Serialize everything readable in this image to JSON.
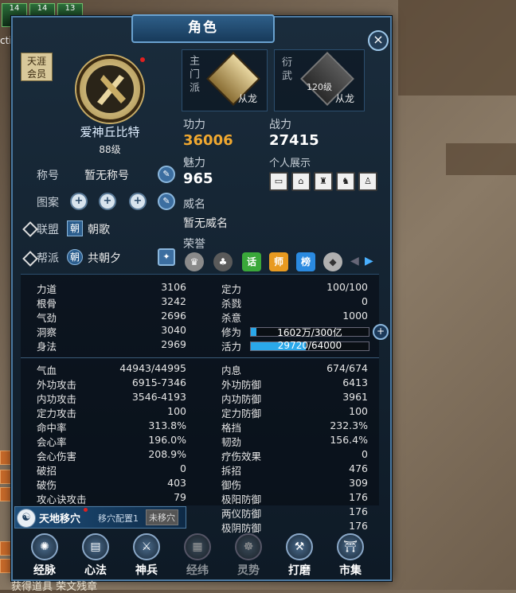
{
  "skill_bar": {
    "counts": [
      "14",
      "14",
      "13"
    ],
    "side_text": "cti"
  },
  "window": {
    "title": "角色",
    "close_symbol": "×"
  },
  "profile": {
    "badge": "天涯\n会员",
    "name": "爱神丘比特",
    "level": "88级",
    "title_label": "称号",
    "title_value": "暂无称号",
    "pattern_label": "图案",
    "alliance_label": "联盟",
    "alliance_tag": "朝",
    "alliance_name": "朝歌",
    "guild_label": "帮派",
    "guild_tag": "朝",
    "guild_name": "共朝夕"
  },
  "sects": {
    "main_label": "主门派",
    "main_name": "从龙",
    "practice_label": "衍武",
    "practice_level": "120级",
    "practice_name": "从龙"
  },
  "power": {
    "gongli_label": "功力",
    "gongli_value": "36006",
    "zhanli_label": "战力",
    "zhanli_value": "27415",
    "meili_label": "魅力",
    "meili_value": "965",
    "personal_show_label": "个人展示",
    "weiming_label": "威名",
    "weiming_value": "暂无威名",
    "honor_label": "荣誉"
  },
  "honor_icons": [
    "话",
    "师",
    "榜"
  ],
  "honor_badge_nums": [
    "1",
    "1",
    "1"
  ],
  "basic_stats_left": [
    {
      "k": "力道",
      "v": "3106"
    },
    {
      "k": "根骨",
      "v": "3242"
    },
    {
      "k": "气劲",
      "v": "2696"
    },
    {
      "k": "洞察",
      "v": "3040"
    },
    {
      "k": "身法",
      "v": "2969"
    }
  ],
  "basic_stats_right": [
    {
      "k": "定力",
      "v": "100/100"
    },
    {
      "k": "杀戮",
      "v": "0"
    },
    {
      "k": "杀意",
      "v": "1000"
    }
  ],
  "xiuwei": {
    "label": "修为",
    "text": "1602万/300亿",
    "fraction": 0.05
  },
  "huoli": {
    "label": "活力",
    "text": "29720/64000",
    "fraction": 0.464
  },
  "combat_left": [
    {
      "k": "气血",
      "v": "44943/44995"
    },
    {
      "k": "外功攻击",
      "v": "6915-7346"
    },
    {
      "k": "内功攻击",
      "v": "3546-4193"
    },
    {
      "k": "定力攻击",
      "v": "100"
    },
    {
      "k": "命中率",
      "v": "313.8%"
    },
    {
      "k": "会心率",
      "v": "196.0%"
    },
    {
      "k": "会心伤害",
      "v": "208.9%"
    },
    {
      "k": "破招",
      "v": "0"
    },
    {
      "k": "破伤",
      "v": "403"
    },
    {
      "k": "攻心诀攻击",
      "v": "79"
    }
  ],
  "combat_right": [
    {
      "k": "内息",
      "v": "674/674"
    },
    {
      "k": "外功防御",
      "v": "6413"
    },
    {
      "k": "内功防御",
      "v": "3961"
    },
    {
      "k": "定力防御",
      "v": "100"
    },
    {
      "k": "格挡",
      "v": "232.3%"
    },
    {
      "k": "韧劲",
      "v": "156.4%"
    },
    {
      "k": "疗伤效果",
      "v": "0"
    },
    {
      "k": "拆招",
      "v": "476"
    },
    {
      "k": "御伤",
      "v": "309"
    },
    {
      "k": "极阳防御",
      "v": "176"
    },
    {
      "k": "两仪防御",
      "v": "176"
    },
    {
      "k": "极阴防御",
      "v": "176"
    }
  ],
  "tiandi": {
    "label": "天地移穴",
    "config": "移穴配置1",
    "status": "未移穴"
  },
  "nav": [
    {
      "label": "经脉",
      "icon": "meridian-icon",
      "dim": false
    },
    {
      "label": "心法",
      "icon": "book-icon",
      "dim": false
    },
    {
      "label": "神兵",
      "icon": "sword-icon",
      "dim": false
    },
    {
      "label": "经纬",
      "icon": "grid-icon",
      "dim": true
    },
    {
      "label": "灵势",
      "icon": "spirit-icon",
      "dim": true
    },
    {
      "label": "打磨",
      "icon": "hammer-icon",
      "dim": false
    },
    {
      "label": "市集",
      "icon": "market-icon",
      "dim": false
    }
  ],
  "footer_text": "获得道具 荣文残章",
  "colors": {
    "accent": "#2aa8ea",
    "gold": "#f0a830",
    "frame": "#4c7aa2"
  }
}
